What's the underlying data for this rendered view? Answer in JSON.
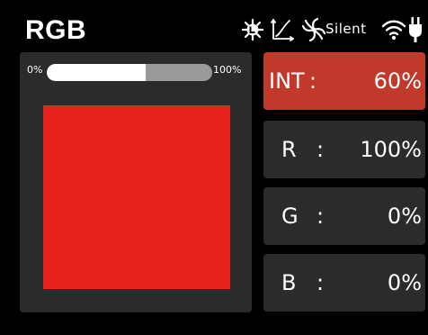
{
  "header": {
    "title": "RGB",
    "status": {
      "silent_label": "Silent"
    },
    "icons": [
      "light-mode-icon",
      "curve-icon",
      "fan-icon",
      "wifi-icon",
      "plug-icon"
    ]
  },
  "slider": {
    "min_label": "0%",
    "max_label": "100%",
    "fill_fraction": 0.6
  },
  "preview": {
    "color": "#e6231b"
  },
  "channels": [
    {
      "key": "INT",
      "sep": ":",
      "value": "60%",
      "active": true
    },
    {
      "key": "R",
      "sep": ":",
      "value": "100%",
      "active": false
    },
    {
      "key": "G",
      "sep": ":",
      "value": "0%",
      "active": false
    },
    {
      "key": "B",
      "sep": ":",
      "value": "0%",
      "active": false
    }
  ],
  "colors": {
    "background": "#000000",
    "panel": "#2b2b2b",
    "active_card": "#c0392b",
    "slider_fill": "#ffffff",
    "slider_track": "#9a9a9a"
  }
}
